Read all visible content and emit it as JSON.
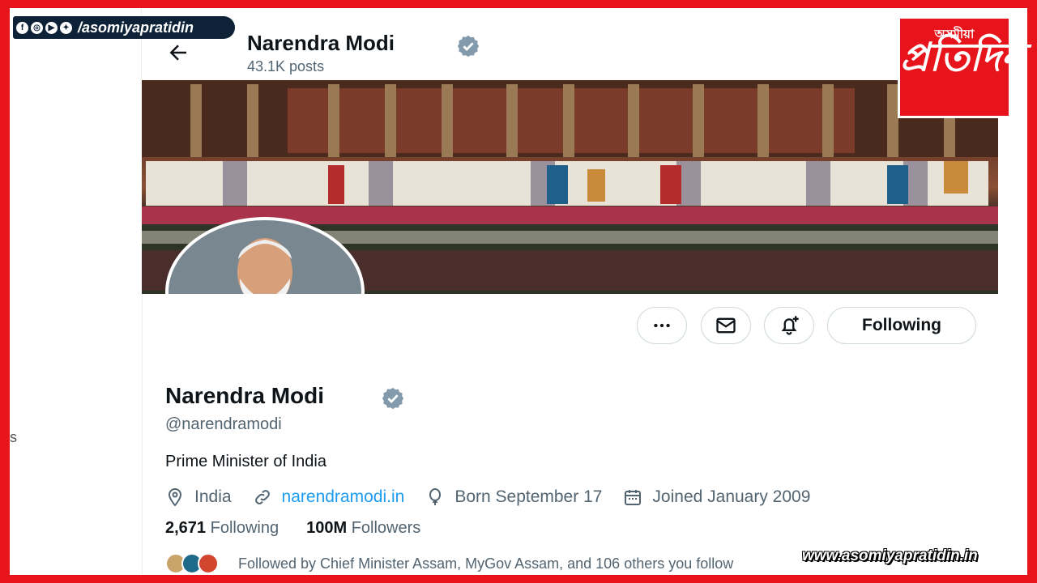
{
  "overlay": {
    "social_icons": [
      "facebook-icon",
      "instagram-icon",
      "youtube-icon",
      "twitter-icon"
    ],
    "social_handle": "/asomiyapratidin",
    "logo_top": "অসমীয়া",
    "logo_main": "প্ৰতিদিন",
    "website": "www.asomiyapratidin.in",
    "frame_color": "#e8141b"
  },
  "header": {
    "title": "Narendra Modi",
    "posts": "43.1K posts"
  },
  "actions": {
    "more_icon": "more-icon",
    "message_icon": "envelope-icon",
    "notify_icon": "bell-plus-icon",
    "following_label": "Following"
  },
  "profile": {
    "name": "Narendra Modi",
    "handle": "@narendramodi",
    "bio": "Prime Minister of India",
    "location": "India",
    "website": "narendramodi.in",
    "birthday": "Born September 17",
    "joined": "Joined January 2009",
    "following_count": "2,671",
    "following_label": "Following",
    "followers_count": "100M",
    "followers_label": "Followers",
    "followed_by": "Followed by Chief Minister Assam, MyGov Assam, and 106 others you follow"
  },
  "colors": {
    "verified": "#829aab",
    "link": "#1d9bf0",
    "text": "#0f1419",
    "muted": "#536471"
  }
}
